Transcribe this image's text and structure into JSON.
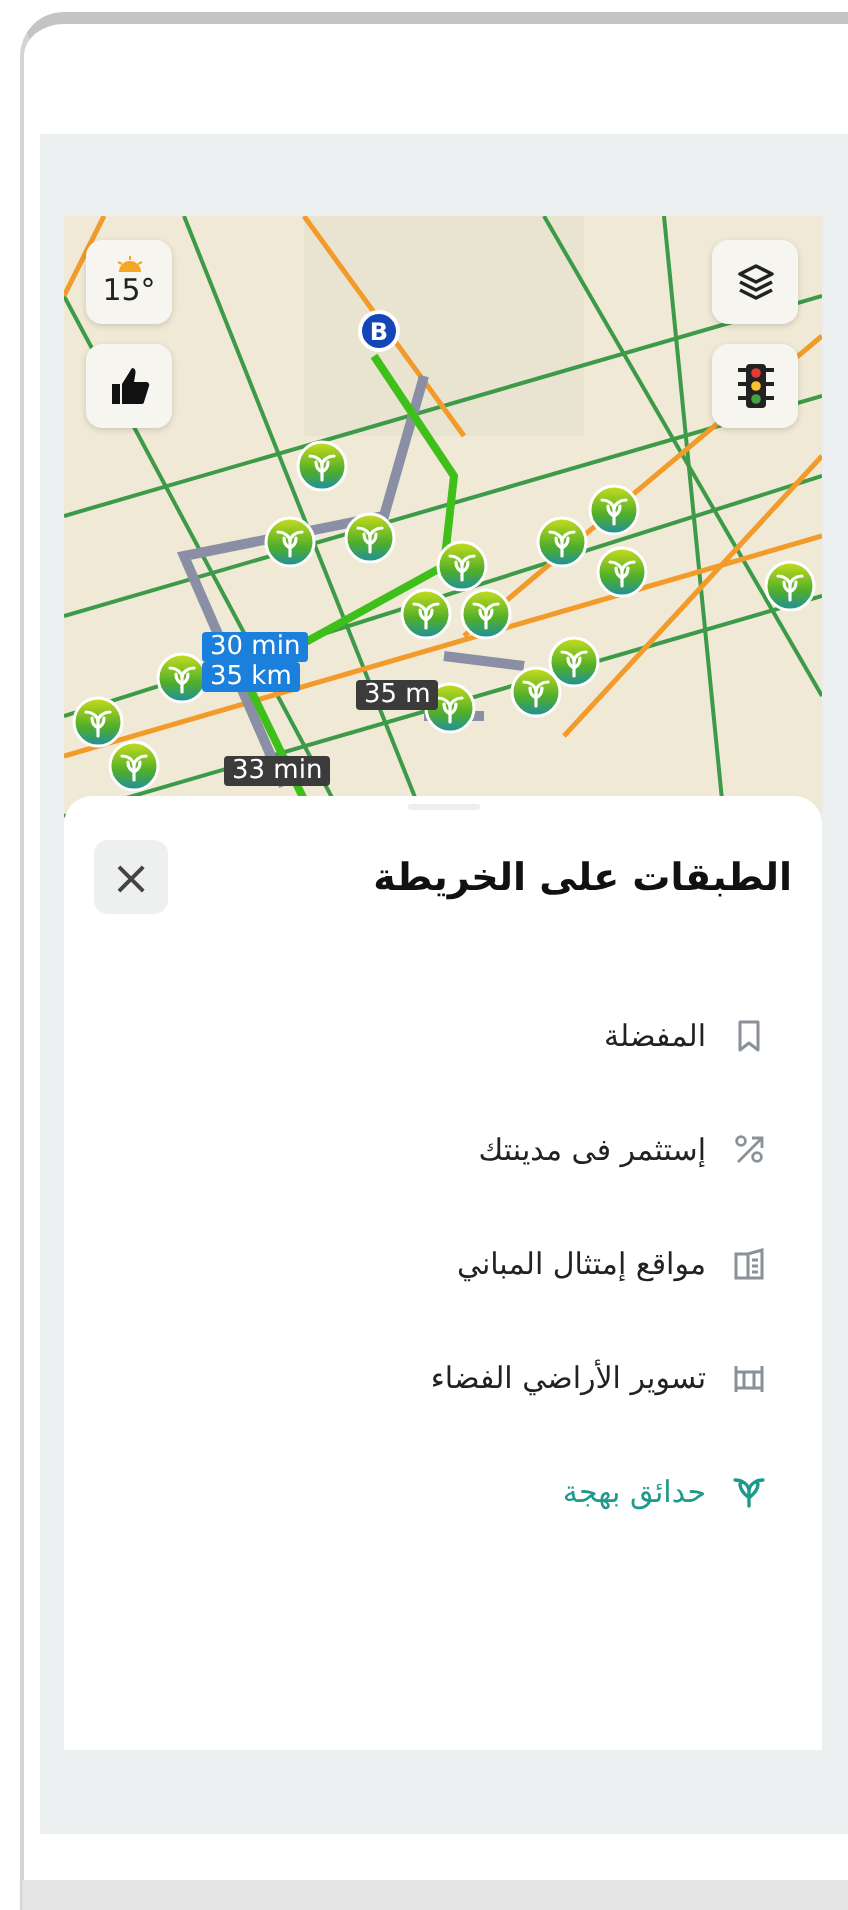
{
  "map": {
    "weather": {
      "temperature": "15°"
    },
    "route_labels": [
      {
        "text": "30 min",
        "kind": "primary"
      },
      {
        "text": "35 km",
        "kind": "primary"
      },
      {
        "text": "35 m",
        "kind": "alt"
      },
      {
        "text": "33 min",
        "kind": "alt"
      }
    ],
    "destination_marker": "B"
  },
  "layers_sheet": {
    "title": "الطبقات على الخريطة",
    "close": "×",
    "items": [
      {
        "label": "المفضلة",
        "kind": "bookmark",
        "selected": false
      },
      {
        "label": "إستثمر فى مدينتك",
        "kind": "percent",
        "selected": false
      },
      {
        "label": "مواقع إمتثال المباني",
        "kind": "building",
        "selected": false
      },
      {
        "label": "تسوير الأراضي الفضاء",
        "kind": "fence",
        "selected": false
      },
      {
        "label": "حدائق بهجة",
        "kind": "park",
        "selected": true
      }
    ]
  }
}
